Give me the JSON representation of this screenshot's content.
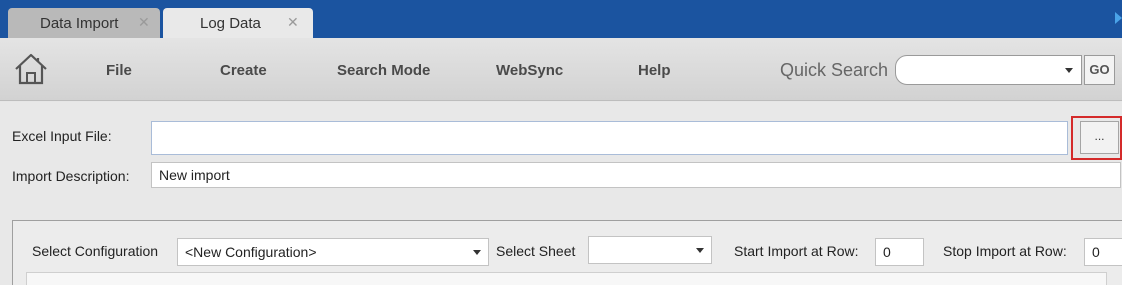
{
  "tabs": [
    {
      "label": "Data Import",
      "close": "✕"
    },
    {
      "label": "Log Data",
      "close": "✕"
    }
  ],
  "menu": {
    "items": [
      "File",
      "Create",
      "Search Mode",
      "WebSync",
      "Help"
    ],
    "quick_search_label": "Quick Search",
    "quick_search_value": "",
    "go_label": "GO"
  },
  "form": {
    "excel_label": "Excel Input File:",
    "excel_value": "",
    "browse_label": "...",
    "desc_label": "Import Description:",
    "desc_value": "New import"
  },
  "config": {
    "select_config_label": "Select Configuration",
    "select_config_value": "<New Configuration>",
    "select_sheet_label": "Select Sheet",
    "select_sheet_value": "",
    "start_row_label": "Start Import at Row:",
    "start_row_value": "0",
    "stop_row_label": "Stop Import at Row:",
    "stop_row_value": "0"
  },
  "colors": {
    "tabbar": "#1b54a0",
    "highlight": "#d42a2a"
  },
  "icons": [
    "home-icon",
    "close-icon",
    "dropdown-arrow-icon",
    "scroll-right-arrow-icon"
  ]
}
